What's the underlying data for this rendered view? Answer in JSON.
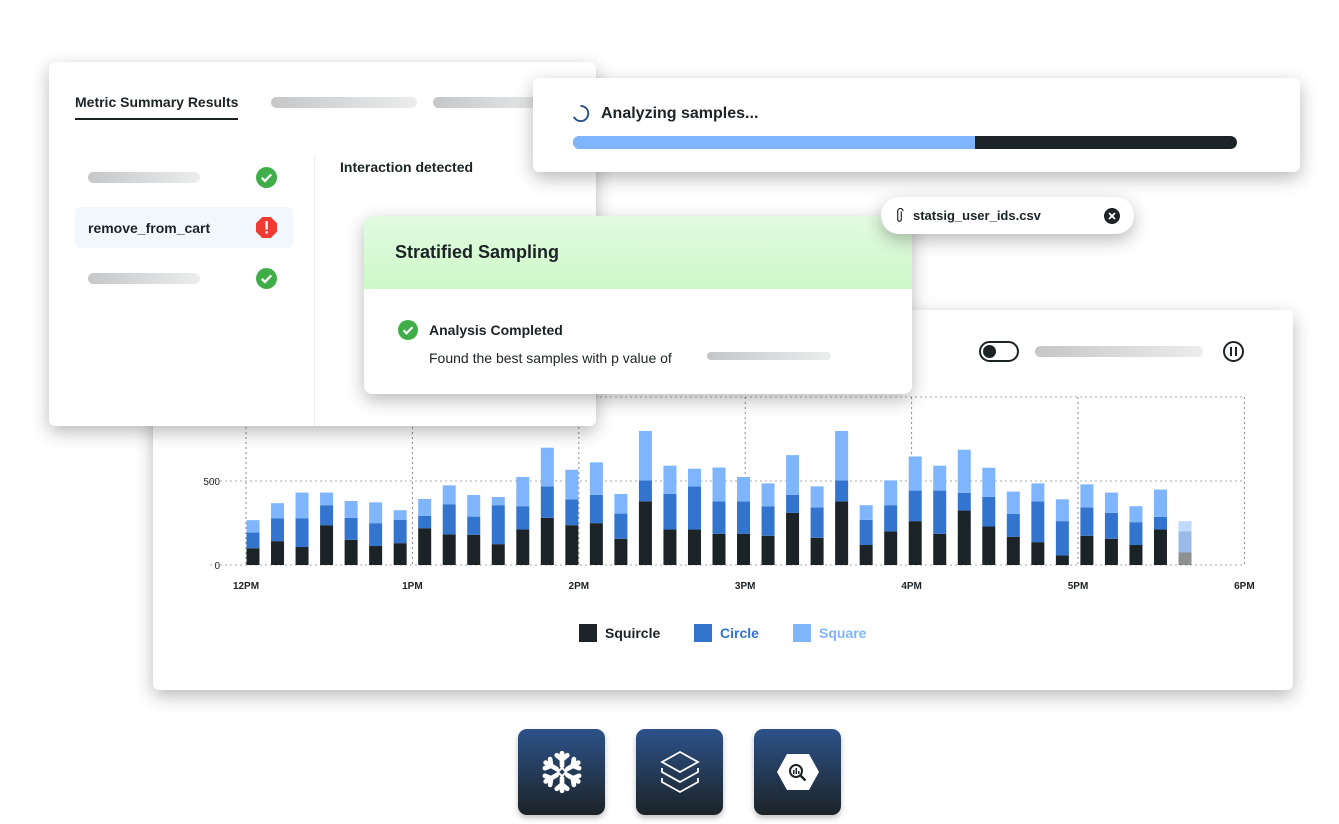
{
  "metric_panel": {
    "tab_title": "Metric Summary Results",
    "rows": [
      {
        "label": "",
        "status": "check-circle-icon"
      },
      {
        "label": "remove_from_cart",
        "status": "alert-octagon-icon"
      },
      {
        "label": "",
        "status": "check-circle-icon"
      }
    ],
    "detail_title": "Interaction detected"
  },
  "analyzing": {
    "title": "Analyzing samples...",
    "progress_percent": 60.5,
    "progress_color": "#7fb5fd",
    "track_color": "#1c2326"
  },
  "file_chip": {
    "filename": "statsig_user_ids.csv",
    "icon": "paperclip-icon",
    "remove_icon": "close-circle-icon"
  },
  "stratified": {
    "title": "Stratified Sampling",
    "status": "Analysis Completed",
    "message": "Found the best samples with p value of"
  },
  "chart_controls": {
    "toggle": "off",
    "pause_icon": "pause-circle-icon"
  },
  "chart_data": {
    "type": "bar",
    "stacked": true,
    "x_tick_labels": [
      "12PM",
      "1PM",
      "2PM",
      "3PM",
      "4PM",
      "5PM",
      "6PM"
    ],
    "y_tick_labels": [
      "0",
      "500"
    ],
    "ylim": [
      0,
      1000
    ],
    "grid": true,
    "legend_position": "bottom",
    "series": [
      {
        "name": "Squircle",
        "color": "#1c2326",
        "values": [
          100,
          142,
          107,
          237,
          150,
          113,
          130,
          219,
          182,
          180,
          124,
          211,
          281,
          237,
          249,
          156,
          379,
          211,
          211,
          186,
          186,
          174,
          310,
          162,
          379,
          119,
          200,
          261,
          186,
          324,
          229,
          168,
          136,
          57,
          174,
          156,
          119,
          211,
          75
        ]
      },
      {
        "name": "Circle",
        "color": "#3374cf",
        "values": [
          93,
          135,
          170,
          119,
          131,
          136,
          139,
          73,
          180,
          108,
          232,
          139,
          187,
          154,
          168,
          150,
          125,
          212,
          257,
          193,
          193,
          176,
          107,
          180,
          125,
          150,
          156,
          182,
          257,
          105,
          176,
          136,
          243,
          204,
          168,
          154,
          136,
          76,
          125
        ]
      },
      {
        "name": "Square",
        "color": "#7fb5fd",
        "values": [
          74,
          91,
          154,
          75,
          100,
          124,
          57,
          101,
          112,
          129,
          49,
          174,
          230,
          176,
          194,
          117,
          294,
          168,
          105,
          201,
          145,
          136,
          237,
          126,
          294,
          87,
          148,
          203,
          148,
          257,
          174,
          133,
          107,
          130,
          138,
          121,
          95,
          162,
          61
        ]
      }
    ]
  },
  "connectors": [
    {
      "name": "snowflake-icon"
    },
    {
      "name": "databricks-icon"
    },
    {
      "name": "bigquery-icon"
    }
  ]
}
